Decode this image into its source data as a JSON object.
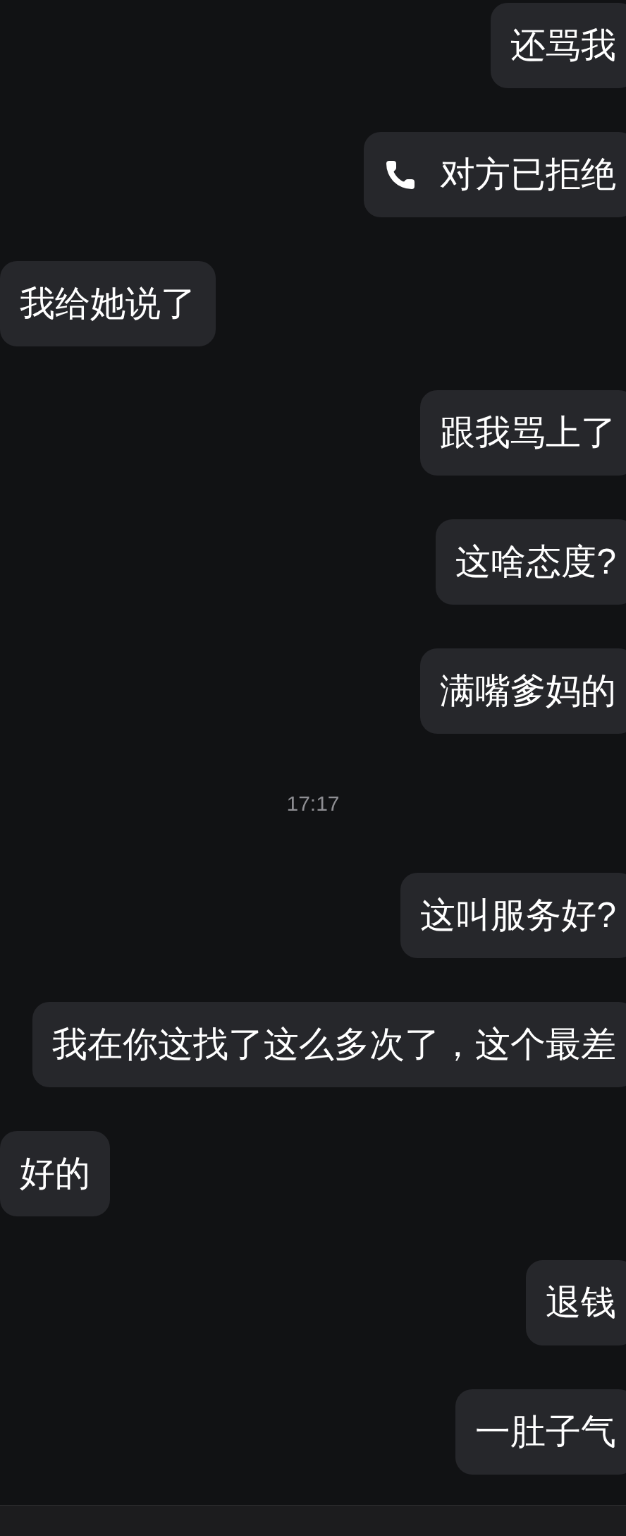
{
  "messages": [
    {
      "kind": "text",
      "outgoing": true,
      "text": "还骂我"
    },
    {
      "kind": "call",
      "outgoing": true,
      "text": "对方已拒绝"
    },
    {
      "kind": "text",
      "outgoing": false,
      "text": "我给她说了"
    },
    {
      "kind": "text",
      "outgoing": true,
      "text": "跟我骂上了"
    },
    {
      "kind": "text",
      "outgoing": true,
      "text": "这啥态度?"
    },
    {
      "kind": "text",
      "outgoing": true,
      "text": "满嘴爹妈的"
    },
    {
      "kind": "time",
      "text": "17:17"
    },
    {
      "kind": "text",
      "outgoing": true,
      "text": "这叫服务好?"
    },
    {
      "kind": "text",
      "outgoing": true,
      "text": "我在你这找了这么多次了，这个最差"
    },
    {
      "kind": "text",
      "outgoing": false,
      "text": "好的"
    },
    {
      "kind": "text",
      "outgoing": true,
      "text": "退钱"
    },
    {
      "kind": "text",
      "outgoing": true,
      "text": "一肚子气"
    }
  ]
}
